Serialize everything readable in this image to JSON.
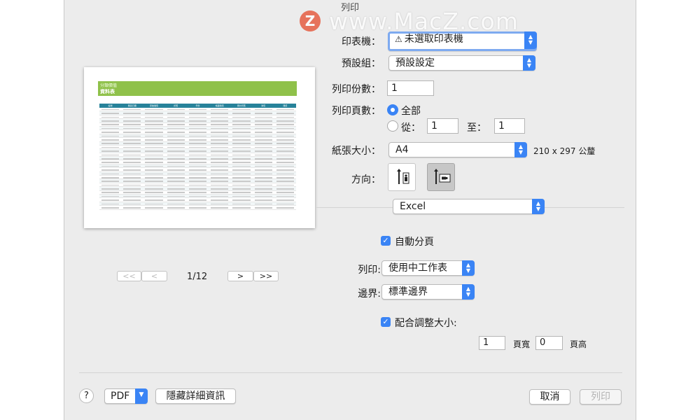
{
  "window": {
    "title": "列印"
  },
  "watermark": {
    "logo_letter": "Z",
    "text": "www.MacZ.com"
  },
  "printer": {
    "label": "印表機：",
    "value": "未選取印表機",
    "warning_icon": "warning-triangle-icon"
  },
  "presets": {
    "label": "預設組：",
    "value": "預設設定"
  },
  "copies": {
    "label": "列印份數：",
    "value": "1"
  },
  "pages": {
    "label": "列印頁數：",
    "all_label": "全部",
    "from_label": "從：",
    "from_value": "1",
    "to_label": "至：",
    "to_value": "1"
  },
  "paper_size": {
    "label": "紙張大小：",
    "value": "A4",
    "dimensions": "210 x 297 公釐"
  },
  "orientation": {
    "label": "方向：",
    "portrait_icon": "portrait-orientation-icon",
    "landscape_icon": "landscape-orientation-icon",
    "selected": "landscape"
  },
  "section_popup": {
    "value": "Excel"
  },
  "auto_paging": {
    "label": "自動分頁",
    "checked": true
  },
  "print_what": {
    "label": "列印:",
    "value": "使用中工作表"
  },
  "margins": {
    "label": "邊界:",
    "value": "標準邊界"
  },
  "fit_to": {
    "label": "配合調整大小:",
    "checked": true,
    "width_value": "1",
    "width_label": "頁寬",
    "height_value": "0",
    "height_label": "頁高"
  },
  "preview": {
    "sheet_subtitle": "分類價值",
    "sheet_title": "資料表",
    "columns": [
      "編號",
      "購買日期",
      "原始價值",
      "折舊",
      "年份",
      "帳面價值",
      "累計折舊",
      "淨值",
      "殘值"
    ],
    "row_count": 27,
    "page_indicator": "1/12",
    "first_label": "<<",
    "prev_label": "<",
    "next_label": ">",
    "last_label": ">>"
  },
  "footer": {
    "help_label": "?",
    "pdf_label": "PDF",
    "hide_details_label": "隱藏詳細資訊",
    "cancel_label": "取消",
    "print_label": "列印"
  },
  "colors": {
    "accent": "#3a84f5",
    "sheet_banner": "#8fc14a",
    "table_header": "#27829a"
  }
}
